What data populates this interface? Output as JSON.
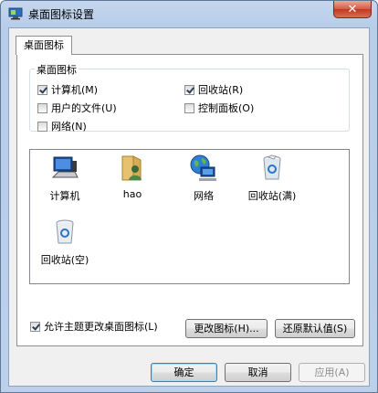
{
  "window": {
    "title": "桌面图标设置"
  },
  "tab": {
    "label": "桌面图标"
  },
  "group": {
    "title": "桌面图标",
    "options": [
      {
        "label": "计算机(M)",
        "checked": true
      },
      {
        "label": "回收站(R)",
        "checked": true
      },
      {
        "label": "用户的文件(U)",
        "checked": false
      },
      {
        "label": "控制面板(O)",
        "checked": false
      },
      {
        "label": "网络(N)",
        "checked": false
      }
    ]
  },
  "icons": [
    {
      "label": "计算机",
      "icon": "computer-icon"
    },
    {
      "label": "hao",
      "icon": "user-folder-icon"
    },
    {
      "label": "网络",
      "icon": "network-globe-icon"
    },
    {
      "label": "回收站(满)",
      "icon": "recycle-bin-full-icon"
    },
    {
      "label": "回收站(空)",
      "icon": "recycle-bin-empty-icon"
    }
  ],
  "buttons": {
    "change_icon": "更改图标(H)...",
    "restore_default": "还原默认值(S)",
    "ok": "确定",
    "cancel": "取消",
    "apply": "应用(A)"
  },
  "theme_option": {
    "label": "允许主题更改桌面图标(L)",
    "checked": true
  },
  "colors": {
    "title_bar": "#bcd0ea",
    "close_button": "#c7432a",
    "default_button_border": "#3c7fb1"
  }
}
